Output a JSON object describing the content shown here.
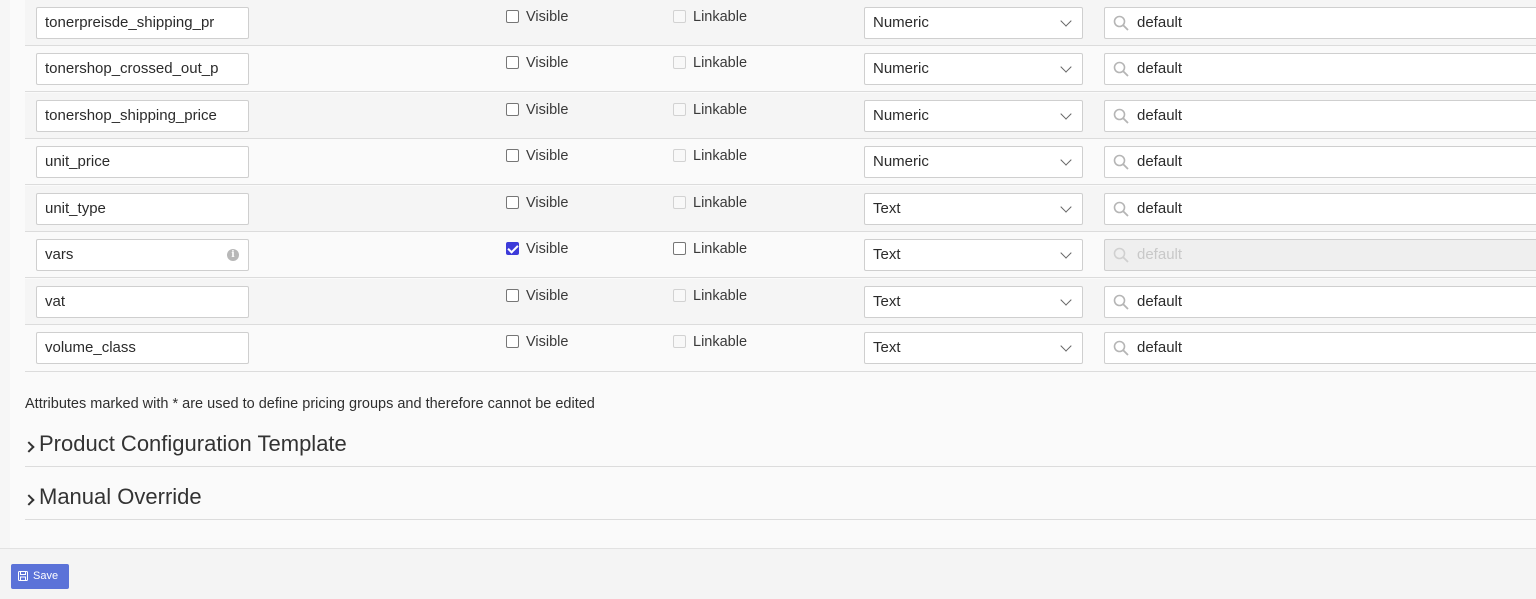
{
  "rows": [
    {
      "name": "tonerpreisde_shipping_pr",
      "visible_label": "Visible",
      "visible_checked": false,
      "linkable_label": "Linkable",
      "linkable_enabled": false,
      "type": "Numeric",
      "search_value": "default",
      "search_disabled": false,
      "info": false
    },
    {
      "name": "tonershop_crossed_out_p",
      "visible_label": "Visible",
      "visible_checked": false,
      "linkable_label": "Linkable",
      "linkable_enabled": false,
      "type": "Numeric",
      "search_value": "default",
      "search_disabled": false,
      "info": false
    },
    {
      "name": "tonershop_shipping_price",
      "visible_label": "Visible",
      "visible_checked": false,
      "linkable_label": "Linkable",
      "linkable_enabled": false,
      "type": "Numeric",
      "search_value": "default",
      "search_disabled": false,
      "info": false
    },
    {
      "name": "unit_price",
      "visible_label": "Visible",
      "visible_checked": false,
      "linkable_label": "Linkable",
      "linkable_enabled": false,
      "type": "Numeric",
      "search_value": "default",
      "search_disabled": false,
      "info": false
    },
    {
      "name": "unit_type",
      "visible_label": "Visible",
      "visible_checked": false,
      "linkable_label": "Linkable",
      "linkable_enabled": false,
      "type": "Text",
      "search_value": "default",
      "search_disabled": false,
      "info": false
    },
    {
      "name": "vars",
      "visible_label": "Visible",
      "visible_checked": true,
      "linkable_label": "Linkable",
      "linkable_enabled": true,
      "type": "Text",
      "search_value": "default",
      "search_disabled": true,
      "info": true
    },
    {
      "name": "vat",
      "visible_label": "Visible",
      "visible_checked": false,
      "linkable_label": "Linkable",
      "linkable_enabled": false,
      "type": "Text",
      "search_value": "default",
      "search_disabled": false,
      "info": false
    },
    {
      "name": "volume_class",
      "visible_label": "Visible",
      "visible_checked": false,
      "linkable_label": "Linkable",
      "linkable_enabled": false,
      "type": "Text",
      "search_value": "default",
      "search_disabled": false,
      "info": false
    }
  ],
  "note": "Attributes marked with * are used to define pricing groups and therefore cannot be edited",
  "sections": [
    {
      "title": "Product Configuration Template"
    },
    {
      "title": "Manual Override"
    }
  ],
  "footer": {
    "save_label": "Save"
  },
  "colors": {
    "accent": "#3d3bd9",
    "save_button": "#5b72d8"
  }
}
